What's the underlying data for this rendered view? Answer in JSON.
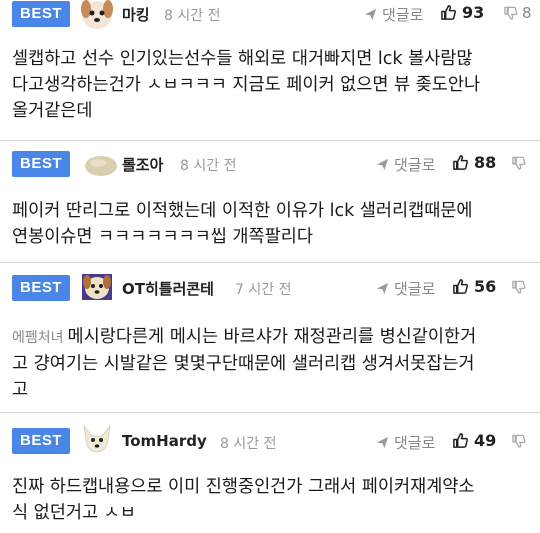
{
  "reply_label": "댓글로",
  "comments": [
    {
      "badge": "BEST",
      "nickname": "마킹",
      "time": "8 시간 전",
      "likes": "93",
      "dislikes": "8",
      "lines": [
        "셀캡하고 선수 인기있는선수들 해외로 대거빠지면 lck 볼사람많",
        "다고생각하는건가 ㅅㅂㅋㅋㅋ 지금도 페이커 없으면 뷰 좆도안나",
        "올거같은데"
      ]
    },
    {
      "badge": "BEST",
      "nickname": "롤조아",
      "time": "8 시간 전",
      "likes": "88",
      "dislikes": "",
      "lines": [
        "페이커 딴리그로 이적했는데 이적한 이유가 lck 샐러리캡때문에",
        "연봉이슈면 ㅋㅋㅋㅋㅋㅋㅋ씹 개쪽팔리다"
      ]
    },
    {
      "badge": "BEST",
      "nickname": "OT히틀러콘테",
      "time": "7 시간 전",
      "likes": "56",
      "dislikes": "",
      "tag": "에펨처녀",
      "lines": [
        "메시랑다른게 메시는 바르샤가 재정관리를 병신같이한거",
        "고 걍여기는 시발같은 몇몇구단때문에 샐러리캡 생겨서못잡는거",
        "고"
      ]
    },
    {
      "badge": "BEST",
      "nickname": "TomHardy",
      "time": "8 시간 전",
      "likes": "49",
      "dislikes": "",
      "lines": [
        "진짜 하드캡내용으로 이미 진행중인건가 그래서 페이커재계약소",
        "식 없던거고 ㅅㅂ"
      ]
    }
  ]
}
